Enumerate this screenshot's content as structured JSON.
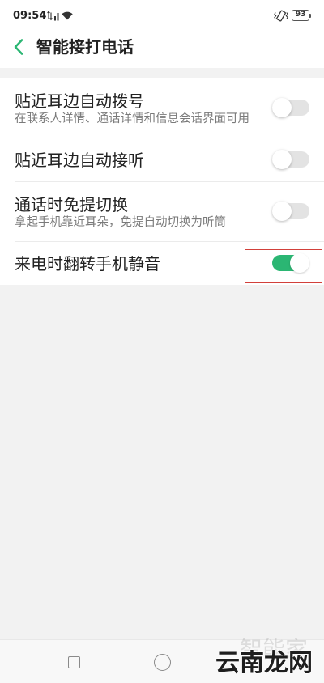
{
  "status_bar": {
    "time": "09:54",
    "battery_level": "93",
    "icons": [
      "signal-icon",
      "wifi-icon",
      "vibrate-icon",
      "battery-icon"
    ]
  },
  "header": {
    "title": "智能接打电话",
    "back_icon": "chevron-left-icon"
  },
  "settings": [
    {
      "title": "贴近耳边自动拨号",
      "subtitle": "在联系人详情、通话详情和信息会话界面可用",
      "enabled": false
    },
    {
      "title": "贴近耳边自动接听",
      "enabled": false
    },
    {
      "title": "通话时免提切换",
      "subtitle": "拿起手机靠近耳朵，免提自动切换为听筒",
      "enabled": false
    },
    {
      "title": "来电时翻转手机静音",
      "enabled": true
    }
  ],
  "navigation_bar": {
    "icons": [
      "recents-icon",
      "home-icon"
    ]
  },
  "watermark": {
    "text": "云南龙网",
    "faint_text": "智能家"
  },
  "colors": {
    "accent": "#2bb673",
    "toggle_off": "#e3e3e3",
    "page_background": "#f2f2f2",
    "highlight": "#d2403a"
  }
}
